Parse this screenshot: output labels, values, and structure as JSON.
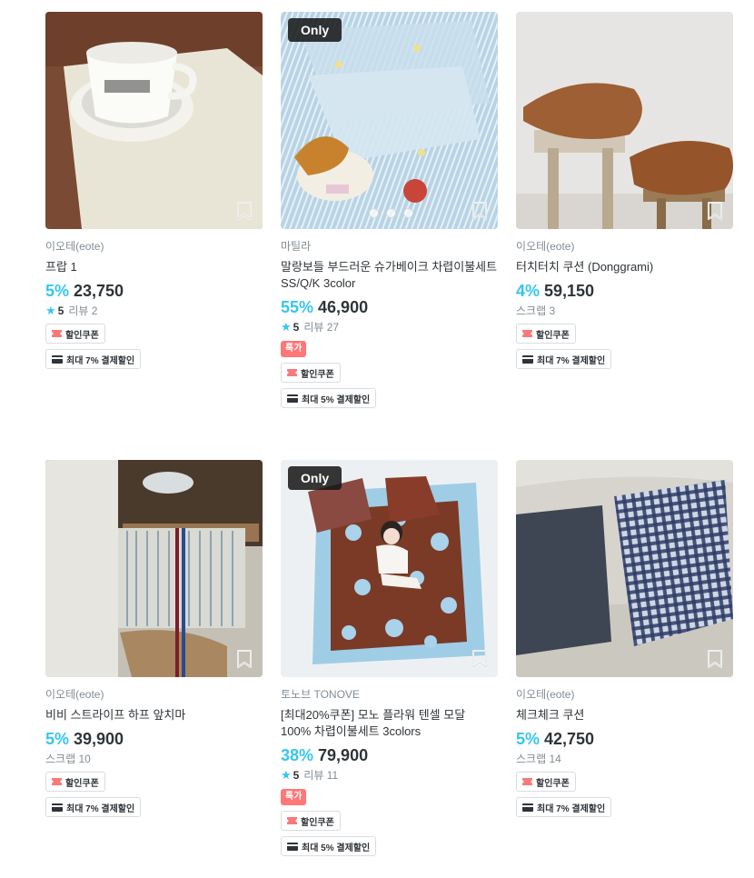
{
  "icons": {
    "bookmark": "bookmark-icon",
    "star": "star-icon",
    "coupon": "coupon-icon",
    "card": "card-icon"
  },
  "colors": {
    "accent": "#35c5f0",
    "sale_badge": "#ff7777",
    "coupon_icon": "#f77a7a"
  },
  "products": [
    {
      "brand": "이오테(eote)",
      "name": "프랍 1",
      "discount": "5%",
      "price": "23,750",
      "rating": "5",
      "reviews": "리뷰 2",
      "scrap": null,
      "only": false,
      "dots": false,
      "sale_badge": null,
      "coupon": "할인쿠폰",
      "pay_discount": "최대 7% 결제할인"
    },
    {
      "brand": "마틸라",
      "name": "말랑보들 부드러운 슈가베이크 차렵이불세트 SS/Q/K 3color",
      "discount": "55%",
      "price": "46,900",
      "rating": "5",
      "reviews": "리뷰 27",
      "scrap": null,
      "only": true,
      "only_label": "Only",
      "dots": true,
      "sale_badge": "특가",
      "coupon": "할인쿠폰",
      "pay_discount": "최대 5% 결제할인"
    },
    {
      "brand": "이오테(eote)",
      "name": "터치터치 쿠션 (Donggrami)",
      "discount": "4%",
      "price": "59,150",
      "rating": null,
      "reviews": null,
      "scrap": "스크랩 3",
      "only": false,
      "dots": false,
      "sale_badge": null,
      "coupon": "할인쿠폰",
      "pay_discount": "최대 7% 결제할인"
    },
    {
      "brand": "이오테(eote)",
      "name": "비비 스트라이프 하프 앞치마",
      "discount": "5%",
      "price": "39,900",
      "rating": null,
      "reviews": null,
      "scrap": "스크랩 10",
      "only": false,
      "dots": false,
      "sale_badge": null,
      "coupon": "할인쿠폰",
      "pay_discount": "최대 7% 결제할인"
    },
    {
      "brand": "토노브 TONOVE",
      "name": "[최대20%쿠폰] 모노 플라워 텐셀 모달 100% 차렵이불세트 3colors",
      "discount": "38%",
      "price": "79,900",
      "rating": "5",
      "reviews": "리뷰 11",
      "scrap": null,
      "only": true,
      "only_label": "Only",
      "dots": false,
      "sale_badge": "특가",
      "coupon": "할인쿠폰",
      "pay_discount": "최대 5% 결제할인"
    },
    {
      "brand": "이오테(eote)",
      "name": "체크체크 쿠션",
      "discount": "5%",
      "price": "42,750",
      "rating": null,
      "reviews": null,
      "scrap": "스크랩 14",
      "only": false,
      "dots": false,
      "sale_badge": null,
      "coupon": "할인쿠폰",
      "pay_discount": "최대 7% 결제할인"
    }
  ]
}
